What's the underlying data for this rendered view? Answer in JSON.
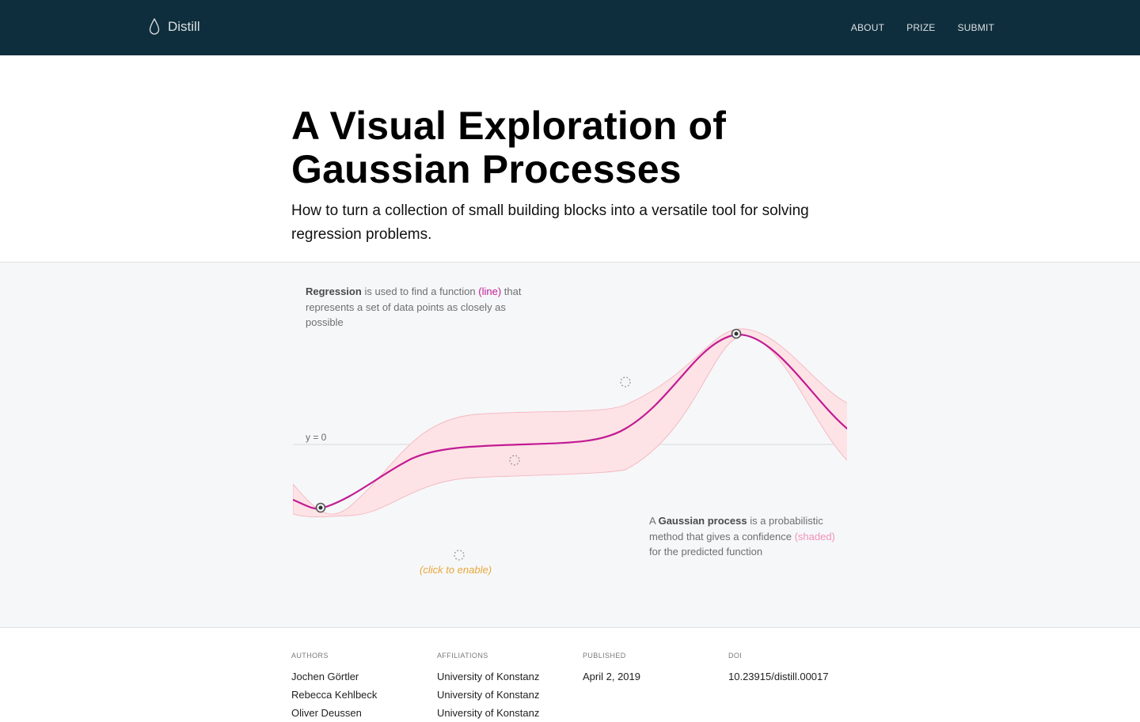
{
  "header": {
    "brand": "Distill",
    "nav": [
      "ABOUT",
      "PRIZE",
      "SUBMIT"
    ]
  },
  "article": {
    "title_line1": "A Visual Exploration of",
    "title_line2": "Gaussian Processes",
    "subtitle": "How to turn a collection of small building blocks into a versatile tool for solving regression problems."
  },
  "figure": {
    "top_annotation": {
      "bold": "Regression",
      "text1": "is used to find a function",
      "highlight": "(line)",
      "text2": "that represents a set of data points as closely as possible"
    },
    "bottom_annotation": {
      "prefix": "A",
      "bold": "Gaussian process",
      "text1": "is a probabilistic method that gives a confidence",
      "highlight": "(shaded)",
      "text2": "for the predicted function"
    },
    "y_zero_label": "y = 0",
    "click_to_enable": "(click to enable)",
    "colors": {
      "mean_line": "#c21b94",
      "confidence_fill": "#fde3e5",
      "confidence_stroke": "#f4b6c2",
      "enable_text": "#e8a83a"
    }
  },
  "byline": {
    "authors_label": "AUTHORS",
    "authors": [
      "Jochen Görtler",
      "Rebecca Kehlbeck",
      "Oliver Deussen"
    ],
    "affiliations_label": "AFFILIATIONS",
    "affiliations": [
      "University of Konstanz",
      "University of Konstanz",
      "University of Konstanz"
    ],
    "published_label": "PUBLISHED",
    "published": "April 2, 2019",
    "doi_label": "DOI",
    "doi": "10.23915/distill.00017"
  }
}
